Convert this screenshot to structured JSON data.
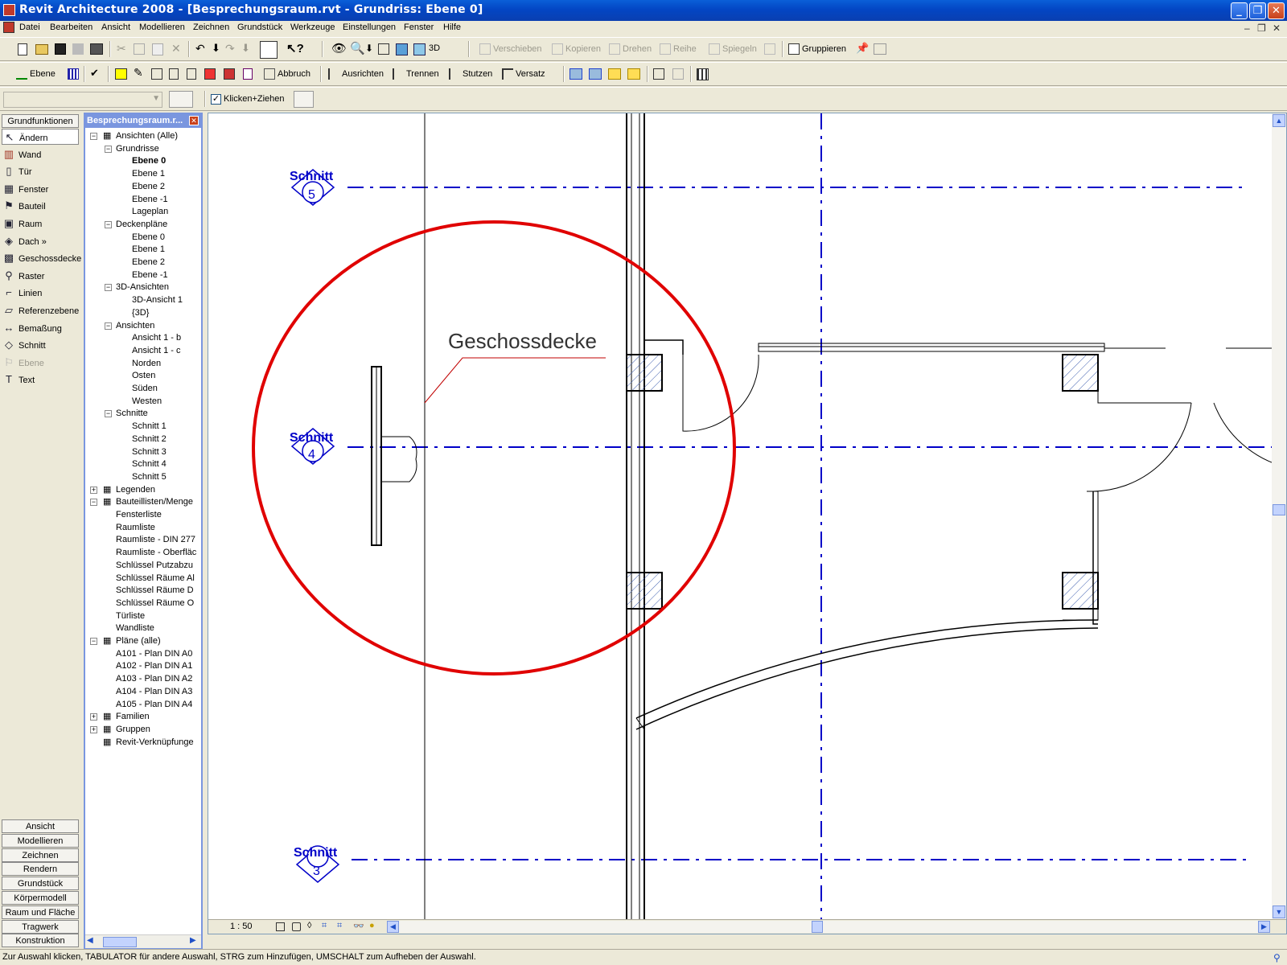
{
  "window": {
    "title": "Revit Architecture 2008 - [Besprechungsraum.rvt - Grundriss: Ebene 0]"
  },
  "menu": [
    "Datei",
    "Bearbeiten",
    "Ansicht",
    "Modellieren",
    "Zeichnen",
    "Grundstück",
    "Werkzeuge",
    "Einstellungen",
    "Fenster",
    "Hilfe"
  ],
  "toolbar1": {
    "threed": "3D",
    "verschieben": "Verschieben",
    "kopieren": "Kopieren",
    "drehen": "Drehen",
    "reihe": "Reihe",
    "spiegeln": "Spiegeln",
    "gruppieren": "Gruppieren"
  },
  "toolbar2": {
    "ebene": "Ebene",
    "abbruch": "Abbruch",
    "ausrichten": "Ausrichten",
    "trennen": "Trennen",
    "stutzen": "Stutzen",
    "versatz": "Versatz"
  },
  "options": {
    "klicken_ziehen": "Klicken+Ziehen",
    "type_selector": ""
  },
  "design_bar": {
    "header": "Grundfunktionen",
    "tools": [
      "Ändern",
      "Wand",
      "Tür",
      "Fenster",
      "Bauteil",
      "Raum",
      "Dach »",
      "Geschossdecke",
      "Raster",
      "Linien",
      "Referenzebene",
      "Bemaßung",
      "Schnitt",
      "Ebene",
      "Text"
    ],
    "tabs": [
      "Ansicht",
      "Modellieren",
      "Zeichnen",
      "Rendern",
      "Grundstück",
      "Körpermodell",
      "Raum und Fläche",
      "Tragwerk",
      "Konstruktion"
    ]
  },
  "browser": {
    "title": "Besprechungsraum.r...",
    "nodes": [
      {
        "label": "Ansichten (Alle)",
        "level": 0,
        "toggle": "-"
      },
      {
        "label": "Grundrisse",
        "level": 1,
        "toggle": "-"
      },
      {
        "label": "Ebene 0",
        "level": 2,
        "bold": true
      },
      {
        "label": "Ebene 1",
        "level": 2
      },
      {
        "label": "Ebene 2",
        "level": 2
      },
      {
        "label": "Ebene -1",
        "level": 2
      },
      {
        "label": "Lageplan",
        "level": 2
      },
      {
        "label": "Deckenpläne",
        "level": 1,
        "toggle": "-"
      },
      {
        "label": "Ebene 0",
        "level": 2
      },
      {
        "label": "Ebene 1",
        "level": 2
      },
      {
        "label": "Ebene 2",
        "level": 2
      },
      {
        "label": "Ebene -1",
        "level": 2
      },
      {
        "label": "3D-Ansichten",
        "level": 1,
        "toggle": "-"
      },
      {
        "label": "3D-Ansicht 1",
        "level": 2
      },
      {
        "label": "{3D}",
        "level": 2
      },
      {
        "label": "Ansichten",
        "level": 1,
        "toggle": "-"
      },
      {
        "label": "Ansicht 1 - b",
        "level": 2
      },
      {
        "label": "Ansicht 1 - c",
        "level": 2
      },
      {
        "label": "Norden",
        "level": 2
      },
      {
        "label": "Osten",
        "level": 2
      },
      {
        "label": "Süden",
        "level": 2
      },
      {
        "label": "Westen",
        "level": 2
      },
      {
        "label": "Schnitte",
        "level": 1,
        "toggle": "-"
      },
      {
        "label": "Schnitt 1",
        "level": 2
      },
      {
        "label": "Schnitt 2",
        "level": 2
      },
      {
        "label": "Schnitt 3",
        "level": 2
      },
      {
        "label": "Schnitt 4",
        "level": 2
      },
      {
        "label": "Schnitt 5",
        "level": 2
      },
      {
        "label": "Legenden",
        "level": 0,
        "toggle": "+"
      },
      {
        "label": "Bauteillisten/Menge",
        "level": 0,
        "toggle": "-"
      },
      {
        "label": "Fensterliste",
        "level": 1
      },
      {
        "label": "Raumliste",
        "level": 1
      },
      {
        "label": "Raumliste - DIN 277",
        "level": 1
      },
      {
        "label": "Raumliste - Oberfläc",
        "level": 1
      },
      {
        "label": "Schlüssel Putzabzu",
        "level": 1
      },
      {
        "label": "Schlüssel Räume Al",
        "level": 1
      },
      {
        "label": "Schlüssel Räume D",
        "level": 1
      },
      {
        "label": "Schlüssel Räume O",
        "level": 1
      },
      {
        "label": "Türliste",
        "level": 1
      },
      {
        "label": "Wandliste",
        "level": 1
      },
      {
        "label": "Pläne (alle)",
        "level": 0,
        "toggle": "-"
      },
      {
        "label": "A101 - Plan DIN A0",
        "level": 1
      },
      {
        "label": "A102 - Plan DIN A1",
        "level": 1
      },
      {
        "label": "A103 - Plan DIN A2",
        "level": 1
      },
      {
        "label": "A104 - Plan DIN A3",
        "level": 1
      },
      {
        "label": "A105 - Plan DIN A4",
        "level": 1
      },
      {
        "label": "Familien",
        "level": 0,
        "toggle": "+"
      },
      {
        "label": "Gruppen",
        "level": 0,
        "toggle": "+"
      },
      {
        "label": "Revit-Verknüpfunge",
        "level": 0
      }
    ]
  },
  "drawing": {
    "annotation": "Geschossdecke",
    "sections": [
      {
        "label": "Schnitt",
        "number": "5"
      },
      {
        "label": "Schnitt",
        "number": "4"
      },
      {
        "label": "Schnitt",
        "number": "3"
      }
    ],
    "highlight_color": "#e00000",
    "section_color": "#0000c8"
  },
  "view_control": {
    "scale": "1 : 50"
  },
  "status": "Zur Auswahl klicken, TABULATOR für andere Auswahl, STRG zum Hinzufügen, UMSCHALT zum Aufheben der Auswahl."
}
